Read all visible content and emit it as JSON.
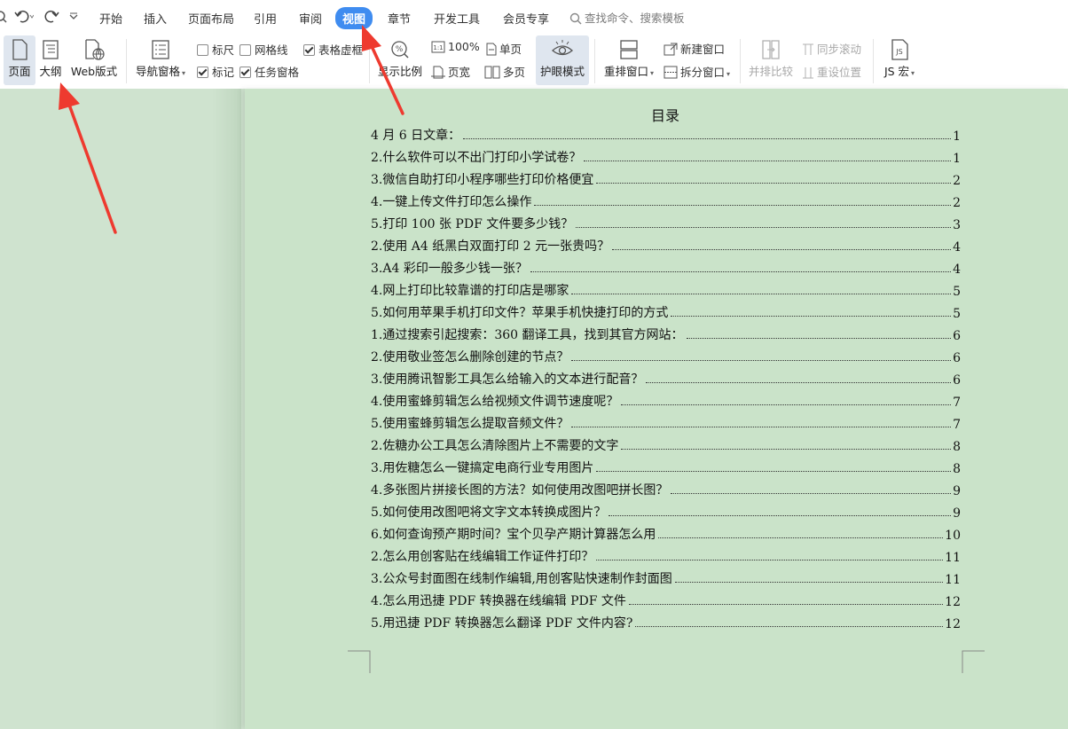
{
  "menu": {
    "tabs": [
      {
        "label": "开始"
      },
      {
        "label": "插入"
      },
      {
        "label": "页面布局"
      },
      {
        "label": "引用"
      },
      {
        "label": "审阅"
      },
      {
        "label": "视图",
        "active": true
      },
      {
        "label": "章节"
      },
      {
        "label": "开发工具"
      },
      {
        "label": "会员专享"
      }
    ],
    "search_placeholder": "查找命令、搜索模板",
    "accent_color": "#3f8cf0"
  },
  "ribbon": {
    "view_page": "页面",
    "view_outline": "大纲",
    "view_web": "Web版式",
    "nav_pane": "导航窗格",
    "ruler": {
      "label": "标尺",
      "checked": false
    },
    "gridlines": {
      "label": "网格线",
      "checked": false
    },
    "table_grid": {
      "label": "表格虚框",
      "checked": true
    },
    "marks": {
      "label": "标记",
      "checked": true
    },
    "task_pane": {
      "label": "任务窗格",
      "checked": true
    },
    "display_ratio": "显示比例",
    "zoom_100": "100%",
    "single_page": "单页",
    "page_width": "页宽",
    "multi_page": "多页",
    "eye_care": "护眼模式",
    "arrange_windows": "重排窗口",
    "new_window": "新建窗口",
    "split_window": "拆分窗口",
    "side_by_side": "并排比较",
    "sync_scroll": "同步滚动",
    "reset_position": "重设位置",
    "js_macro": "JS 宏"
  },
  "document": {
    "toc_title": "目录",
    "entries": [
      {
        "text": "4 月 6 日文章：",
        "page": "1"
      },
      {
        "text": "2.什么软件可以不出门打印小学试卷？",
        "page": "1"
      },
      {
        "text": "3.微信自助打印小程序哪些打印价格便宜",
        "page": "2"
      },
      {
        "text": "4.一键上传文件打印怎么操作",
        "page": "2"
      },
      {
        "text": "5.打印 100 张 PDF 文件要多少钱？",
        "page": "3"
      },
      {
        "text": "2.使用 A4 纸黑白双面打印 2 元一张贵吗？",
        "page": "4"
      },
      {
        "text": "3.A4 彩印一般多少钱一张？",
        "page": "4"
      },
      {
        "text": "4.网上打印比较靠谱的打印店是哪家",
        "page": "5"
      },
      {
        "text": "5.如何用苹果手机打印文件？苹果手机快捷打印的方式",
        "page": "5"
      },
      {
        "text": "1.通过搜索引起搜索：360 翻译工具，找到其官方网站：",
        "page": "6"
      },
      {
        "text": "2.使用敬业签怎么删除创建的节点？",
        "page": "6"
      },
      {
        "text": "3.使用腾讯智影工具怎么给输入的文本进行配音？",
        "page": "6"
      },
      {
        "text": "4.使用蜜蜂剪辑怎么给视频文件调节速度呢？",
        "page": "7"
      },
      {
        "text": "5.使用蜜蜂剪辑怎么提取音频文件？",
        "page": "7"
      },
      {
        "text": "2.佐糖办公工具怎么清除图片上不需要的文字",
        "page": "8"
      },
      {
        "text": "3.用佐糖怎么一键搞定电商行业专用图片",
        "page": "8"
      },
      {
        "text": "4.多张图片拼接长图的方法？如何使用改图吧拼长图？",
        "page": "9"
      },
      {
        "text": "5.如何使用改图吧将文字文本转换成图片？",
        "page": "9"
      },
      {
        "text": "6.如何查询预产期时间？宝个贝孕产期计算器怎么用",
        "page": "10"
      },
      {
        "text": "2.怎么用创客贴在线编辑工作证件打印？",
        "page": "11"
      },
      {
        "text": "3.公众号封面图在线制作编辑,用创客贴快速制作封面图",
        "page": "11"
      },
      {
        "text": "4.怎么用迅捷 PDF 转换器在线编辑 PDF 文件",
        "page": "12"
      },
      {
        "text": "5.用迅捷 PDF 转换器怎么翻译 PDF 文件内容?",
        "page": "12"
      }
    ]
  },
  "colors": {
    "eye_care_background": "#cae3c9",
    "arrow": "#ee3a2f"
  }
}
